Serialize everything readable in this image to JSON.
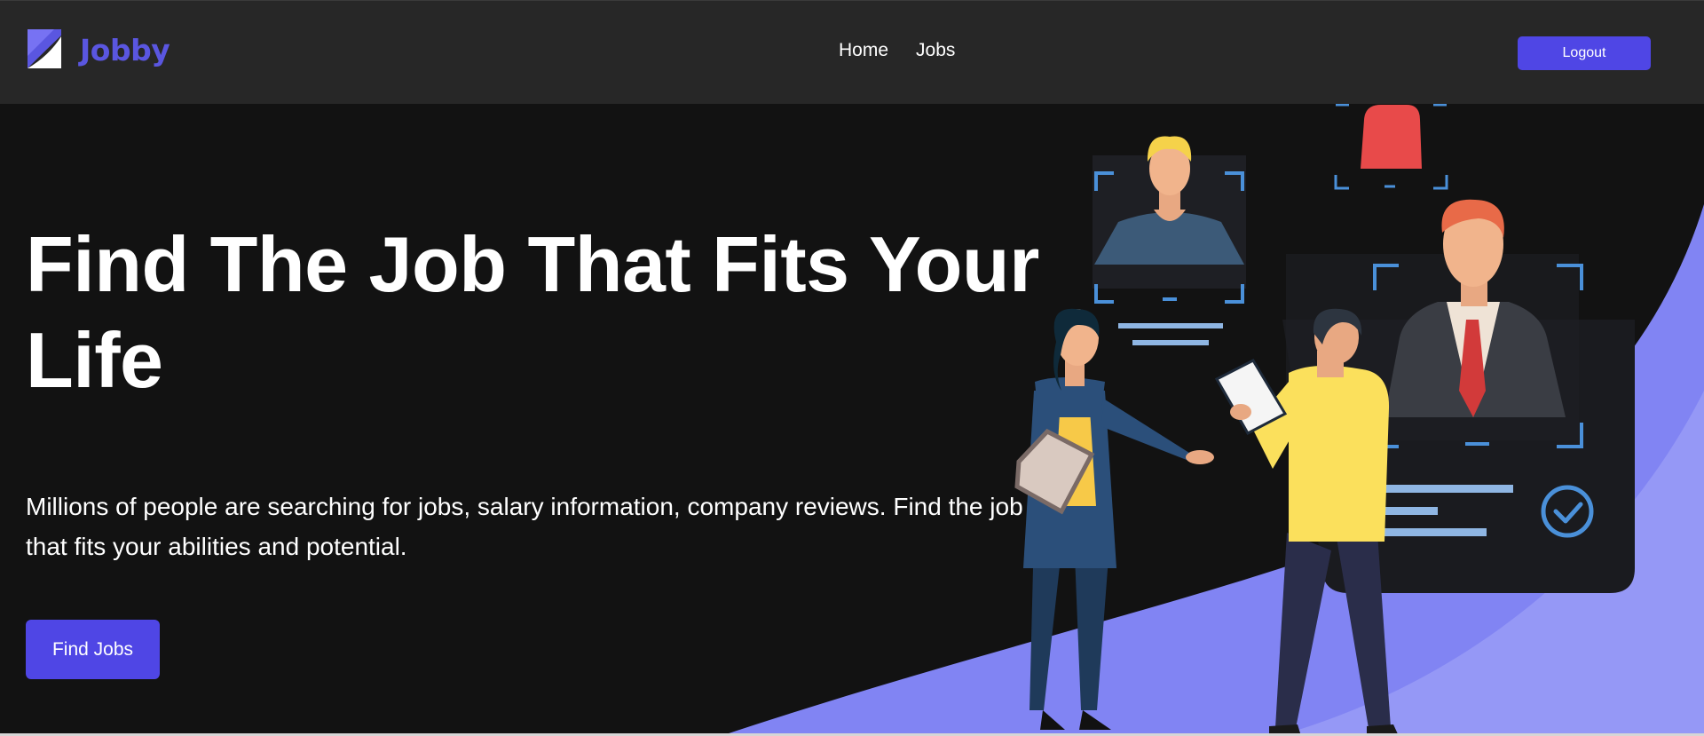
{
  "navbar": {
    "brand": "Jobby",
    "links": [
      {
        "label": "Home"
      },
      {
        "label": "Jobs"
      }
    ],
    "logout_label": "Logout"
  },
  "hero": {
    "title": "Find The Job That Fits Your Life",
    "description": "Millions of people are searching for jobs, salary information, company reviews. Find the job that fits your abilities and potential.",
    "cta_label": "Find Jobs"
  },
  "colors": {
    "accent": "#4f46e5",
    "brand_text": "#5a56e0",
    "navbar_bg": "#272727",
    "page_bg": "#121212",
    "illustration_purple": "#8b8cf5"
  },
  "icons": [
    "jobby-logo-icon",
    "check-circle-icon"
  ]
}
